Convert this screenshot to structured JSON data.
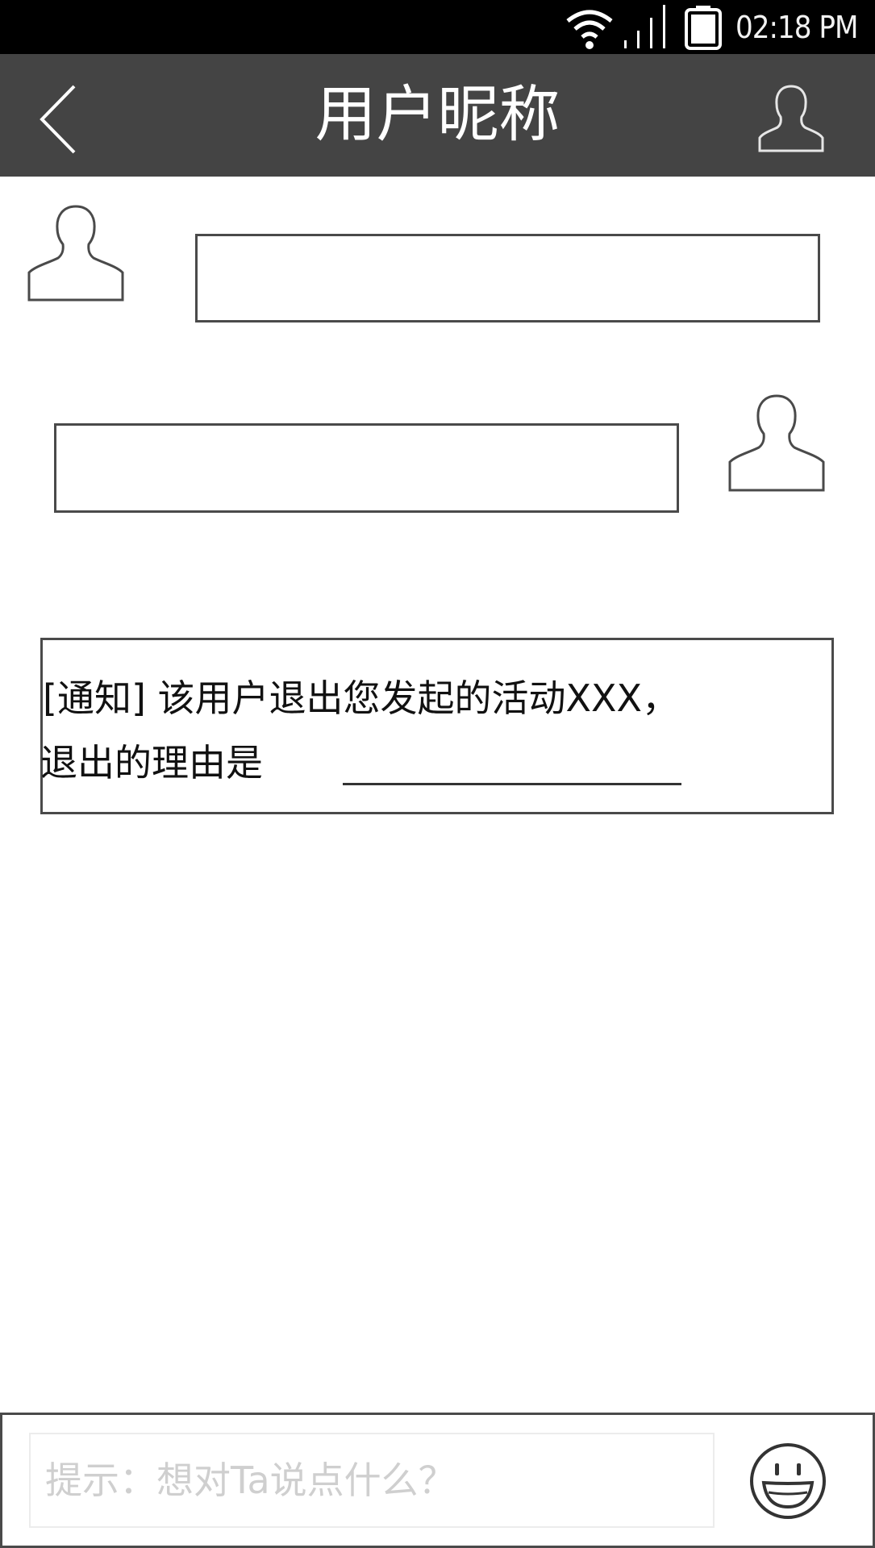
{
  "status_bar": {
    "time": "02:18 PM",
    "icons": [
      "wifi-icon",
      "signal-icon",
      "battery-icon"
    ]
  },
  "app_bar": {
    "title": "用户昵称",
    "back_icon": "chevron-left-icon",
    "profile_icon": "user-icon"
  },
  "messages": [
    {
      "side": "left",
      "avatar": "user-icon",
      "text": ""
    },
    {
      "side": "right",
      "avatar": "user-icon",
      "text": ""
    }
  ],
  "notice": {
    "line1": "[通知] 该用户退出您发起的活动XXX，",
    "line2": "退出的理由是"
  },
  "composer": {
    "placeholder": "提示：想对Ta说点什么？",
    "emoji_icon": "smiley-icon"
  },
  "colors": {
    "status_bar": "#000000",
    "app_bar": "#444444",
    "outline": "#4a4a4a",
    "placeholder": "#cfcfcf"
  }
}
